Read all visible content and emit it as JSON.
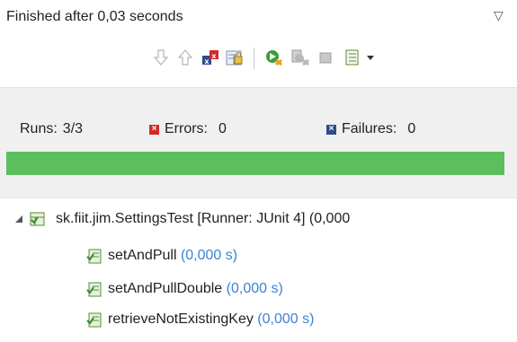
{
  "status": {
    "message": "Finished after 0,03 seconds"
  },
  "counters": {
    "runs_label": "Runs:",
    "runs_value": "3/3",
    "errors_label": "Errors:",
    "errors_value": "0",
    "failures_label": "Failures:",
    "failures_value": "0"
  },
  "progress": {
    "fraction": 1.0,
    "color": "#5cbf5e"
  },
  "toolbar": {
    "icons": [
      "next-failure-icon",
      "previous-failure-icon",
      "show-failures-only-icon",
      "scroll-lock-icon",
      "rerun-test-icon",
      "rerun-failed-first-icon",
      "stop-icon",
      "test-run-history-icon",
      "view-menu-arrow-icon"
    ]
  },
  "tree": {
    "root": {
      "name": "sk.fiit.jim.SettingsTest [Runner: JUnit 4] (0,000"
    },
    "children": [
      {
        "name": "setAndPull",
        "time": "(0,000 s)"
      },
      {
        "name": "setAndPullDouble",
        "time": "(0,000 s)"
      },
      {
        "name": "retrieveNotExistingKey",
        "time": "(0,000 s)"
      }
    ]
  },
  "colors": {
    "time_text": "#3b82d6",
    "error_badge": "#d72828",
    "failure_badge": "#2c4d8c"
  }
}
